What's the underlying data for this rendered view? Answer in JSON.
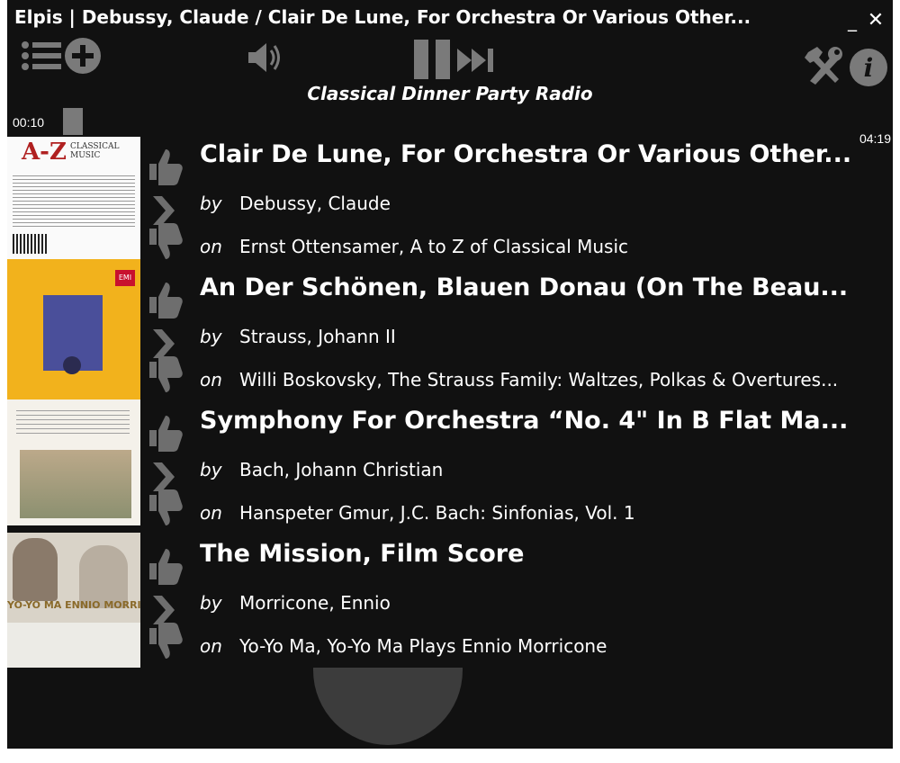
{
  "window": {
    "title": "Elpis | Debussy, Claude / Clair De Lune, For Orchestra Or Various Other...",
    "minimize_label": "_",
    "close_label": "✕"
  },
  "toolbar": {
    "icons": [
      "list-icon",
      "add-icon",
      "volume-icon",
      "pause-icon",
      "skip-icon",
      "settings-icon",
      "info-icon"
    ],
    "info_label": "i"
  },
  "station": {
    "name": "Classical Dinner Party Radio"
  },
  "progress": {
    "elapsed": "00:10",
    "total": "04:19"
  },
  "tracks": [
    {
      "title": "Clair De Lune, For Orchestra Or Various Other...",
      "by_label": "by",
      "artist": "Debussy, Claude",
      "on_label": "on",
      "album": "Ernst Ottensamer, A to Z of Classical Music"
    },
    {
      "title": "An Der Schönen, Blauen Donau (On The Beau...",
      "by_label": "by",
      "artist": "Strauss, Johann II",
      "on_label": "on",
      "album": "Willi Boskovsky, The Strauss Family: Waltzes, Polkas & Overtures..."
    },
    {
      "title": "Symphony For Orchestra “No. 4\" In B Flat Ma...",
      "by_label": "by",
      "artist": "Bach, Johann Christian",
      "on_label": "on",
      "album": "Hanspeter Gmur, J.C. Bach: Sinfonias, Vol. 1"
    },
    {
      "title": "The Mission, Film Score",
      "by_label": "by",
      "artist": "Morricone, Ennio",
      "on_label": "on",
      "album": "Yo-Yo Ma, Yo-Yo Ma Plays Ennio Morricone"
    }
  ],
  "album_art": {
    "cover1_text": "A-Z",
    "cover1_sub": "CLASSICAL MUSIC",
    "cover2_badge": "EMI",
    "cover4_text": "YO-YO MA  ENNIO MORRICONE"
  },
  "colors": {
    "background": "#111111",
    "icon_gray": "#7a7a7a",
    "text": "#ffffff"
  }
}
